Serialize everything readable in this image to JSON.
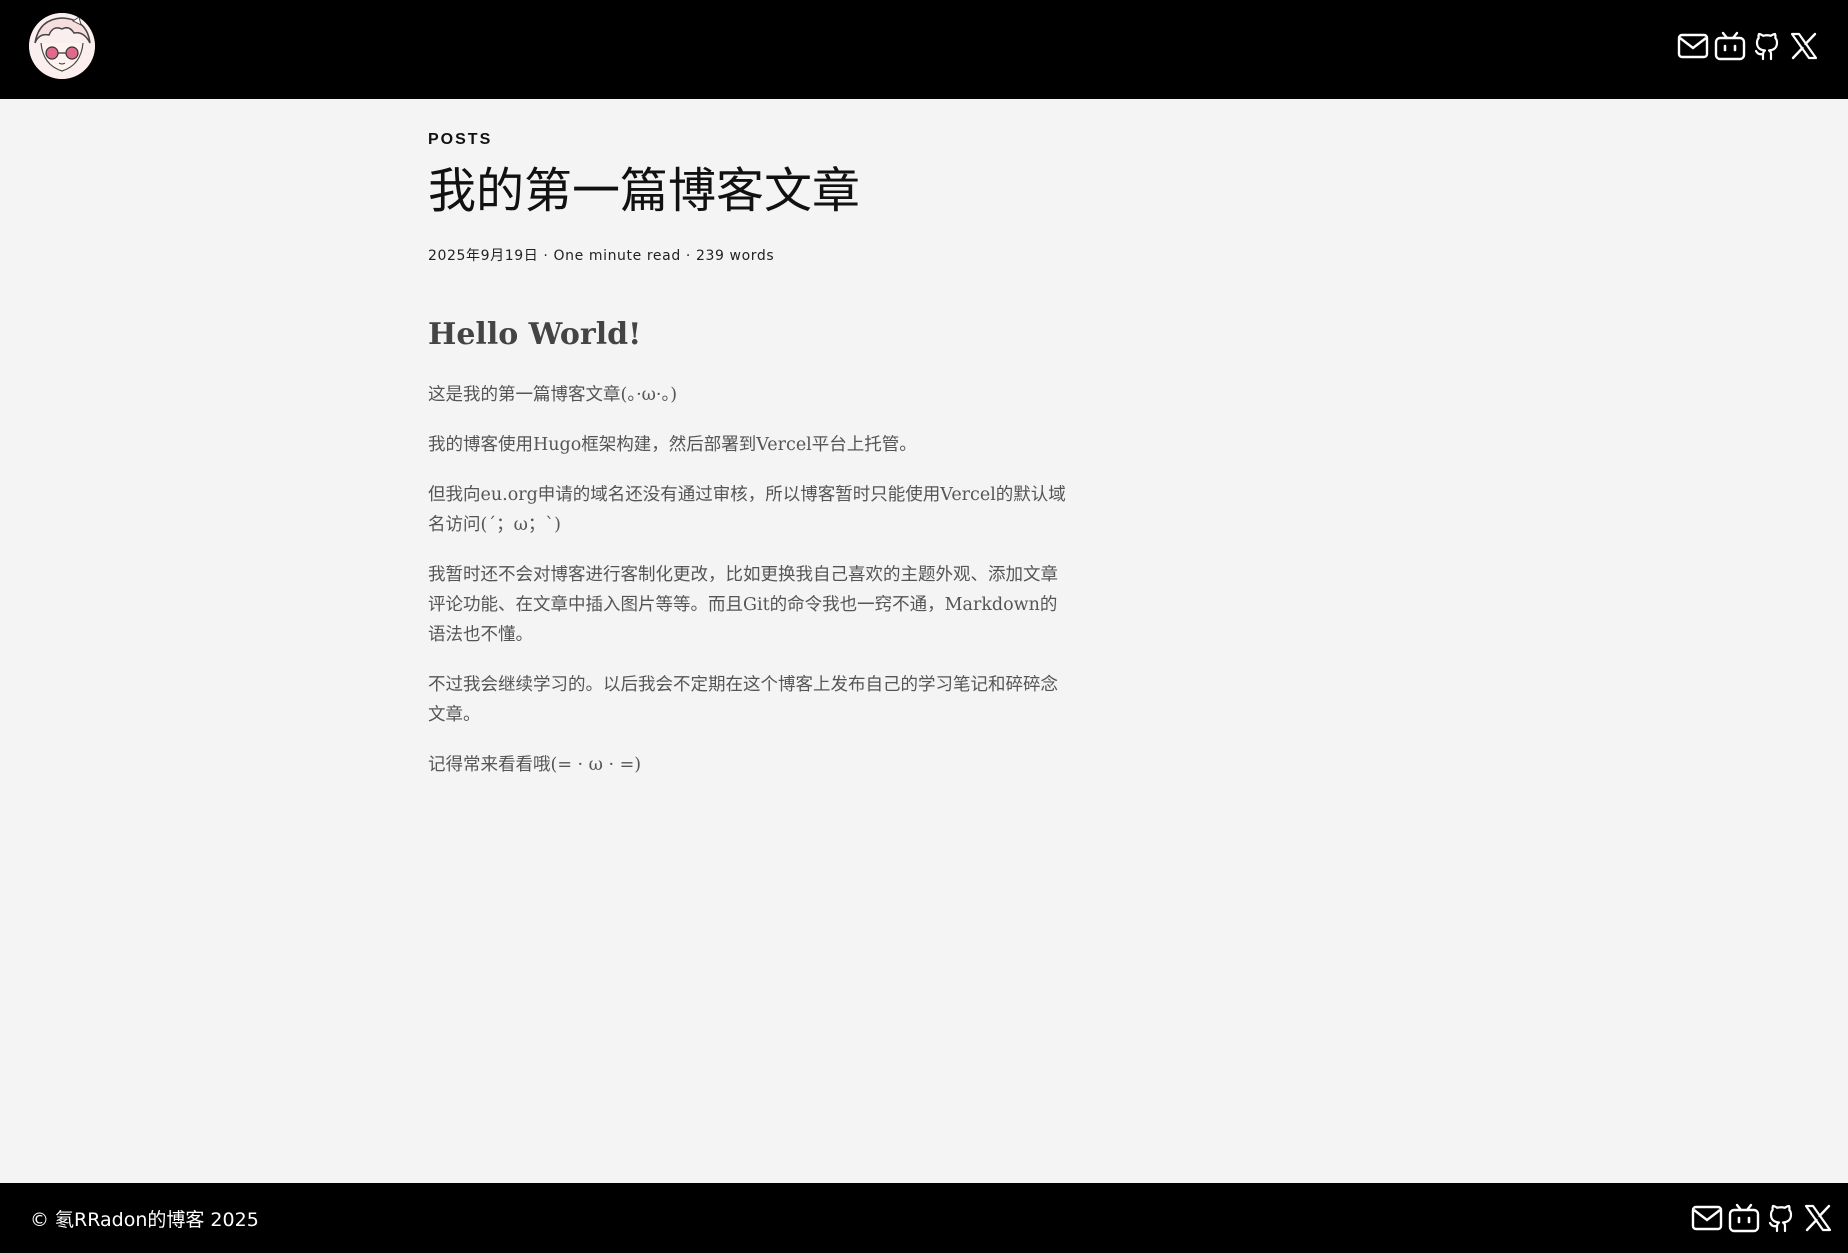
{
  "header": {
    "social": [
      {
        "icon": "mail-icon",
        "name": "email"
      },
      {
        "icon": "bilibili-icon",
        "name": "bilibili"
      },
      {
        "icon": "github-icon",
        "name": "github"
      },
      {
        "icon": "x-icon",
        "name": "x"
      }
    ]
  },
  "post": {
    "section": "POSTS",
    "title": "我的第一篇博客文章",
    "meta": "2025年9月19日 · One minute read · 239 words",
    "heading": "Hello World!",
    "paragraphs": [
      "这是我的第一篇博客文章(。·ω·。)",
      "我的博客使用Hugo框架构建，然后部署到Vercel平台上托管。",
      "但我向eu.org申请的域名还没有通过审核，所以博客暂时只能使用Vercel的默认域名访问(´；ω；`)",
      "我暂时还不会对博客进行客制化更改，比如更换我自己喜欢的主题外观、添加文章评论功能、在文章中插入图片等等。而且Git的命令我也一窍不通，Markdown的语法也不懂。",
      "不过我会继续学习的。以后我会不定期在这个博客上发布自己的学习笔记和碎碎念文章。",
      "记得常来看看哦(= · ω · =)"
    ]
  },
  "footer": {
    "copyright": "© 氡RRadon的博客 2025"
  },
  "colors": {
    "bar": "#000000",
    "page_bg": "#f4f4f4",
    "body_text": "#555555",
    "heading_text": "#444444"
  }
}
